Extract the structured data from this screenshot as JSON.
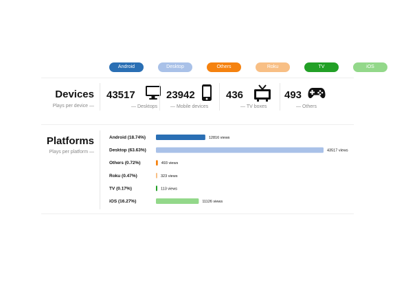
{
  "legend": [
    {
      "label": "Android",
      "color": "#2a6fb4"
    },
    {
      "label": "Desktop",
      "color": "#a9c1e8"
    },
    {
      "label": "Others",
      "color": "#f5820f"
    },
    {
      "label": "Roku",
      "color": "#f8bf85"
    },
    {
      "label": "TV",
      "color": "#22a026"
    },
    {
      "label": "iOS",
      "color": "#93d88a"
    }
  ],
  "devices": {
    "title": "Devices",
    "subtitle": "Plays per device —",
    "items": [
      {
        "count": "43517",
        "label": "— Desktops",
        "icon": "monitor-icon"
      },
      {
        "count": "23942",
        "label": "— Mobile devices",
        "icon": "mobile-phone-icon"
      },
      {
        "count": "436",
        "label": "— TV boxes",
        "icon": "tv-icon"
      },
      {
        "count": "493",
        "label": "— Others",
        "icon": "gamepad-icon"
      }
    ]
  },
  "platforms": {
    "title": "Platforms",
    "subtitle": "Plays per platform —"
  },
  "chart_data": {
    "type": "bar",
    "orientation": "horizontal",
    "categories": [
      "Android (18.74%)",
      "Desktop (63.63%)",
      "Others (0.72%)",
      "Roku (0.47%)",
      "TV (0.17%)",
      "iOS (16.27%)"
    ],
    "values": [
      12816,
      43517,
      493,
      323,
      113,
      11126
    ],
    "value_labels": [
      "12816 views",
      "43517 views",
      "493 views",
      "323 views",
      "113 views",
      "11126 views"
    ],
    "colors": [
      "#2a6fb4",
      "#a9c1e8",
      "#f5820f",
      "#f8bf85",
      "#22a026",
      "#93d88a"
    ],
    "xlim": [
      0,
      43517
    ],
    "grid": false
  }
}
